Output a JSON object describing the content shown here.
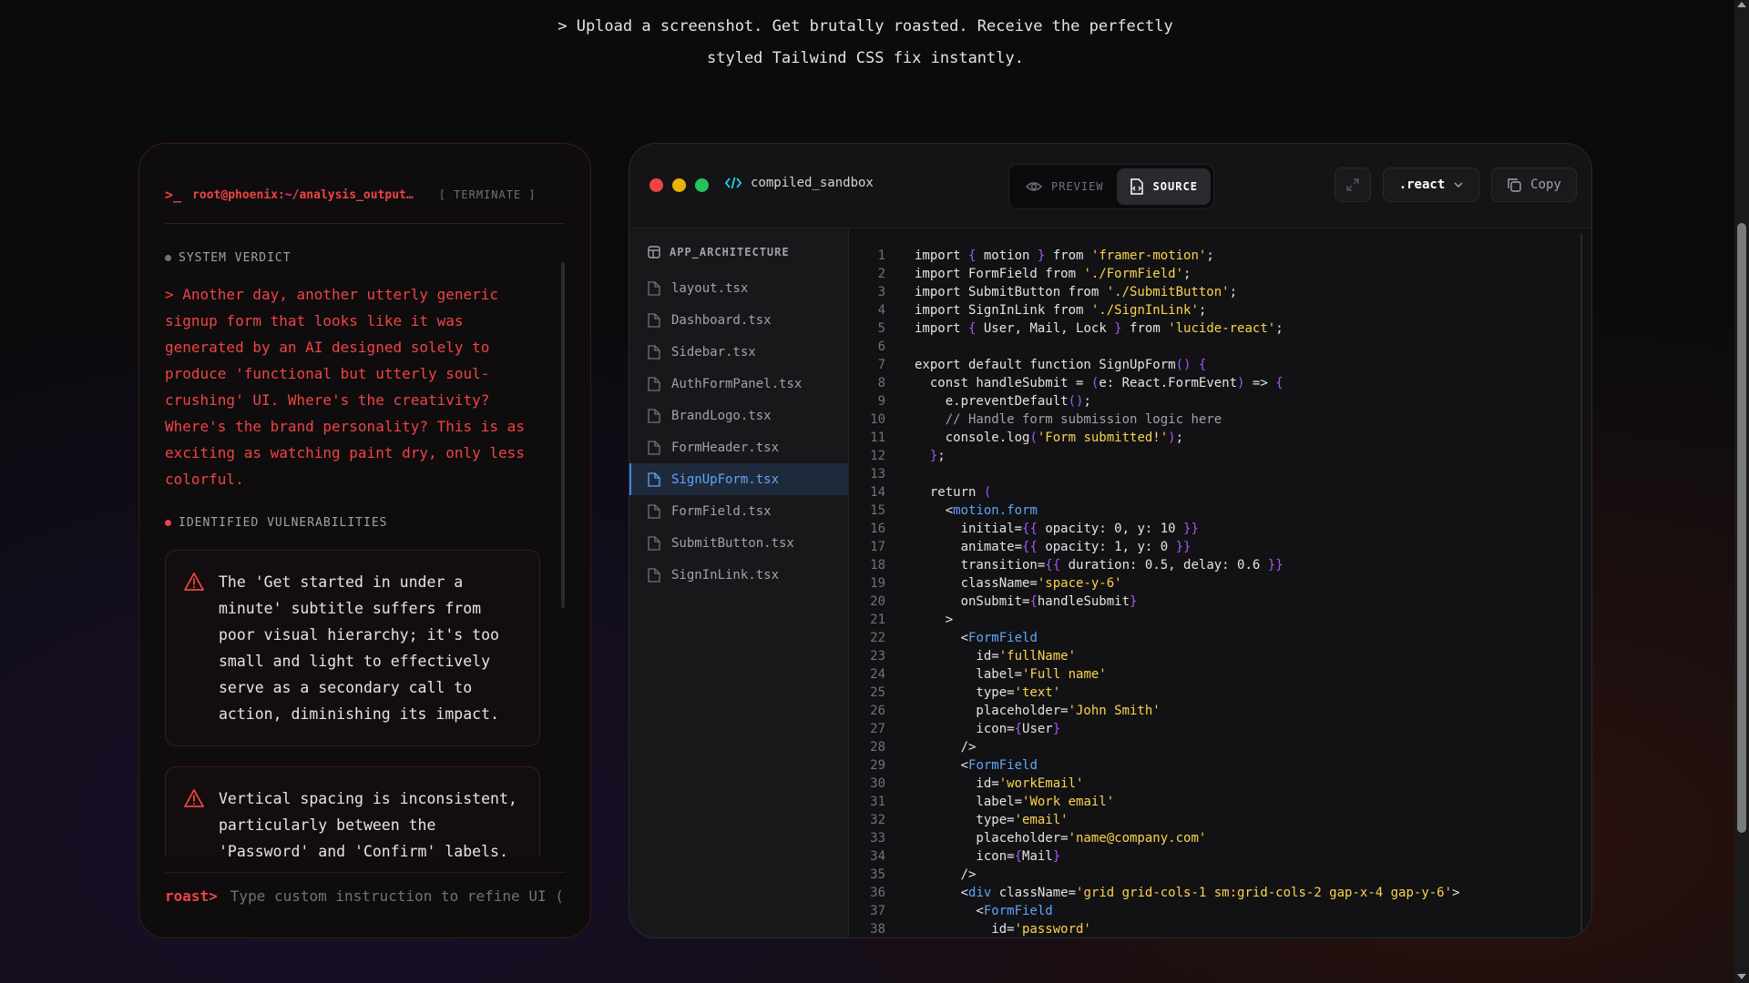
{
  "tagline": {
    "line1": "> Upload a screenshot. Get brutally roasted. Receive the perfectly",
    "line2": "styled Tailwind CSS fix instantly."
  },
  "terminal": {
    "prompt_icon": ">_",
    "path": "root@phoenix:~/analysis_output…",
    "terminate_label": "[ TERMINATE ]",
    "verdict_label": "SYSTEM VERDICT",
    "verdict_text": "> Another day, another utterly generic signup form that looks like it was generated by an AI designed solely to produce 'functional but utterly soul-crushing' UI. Where's the creativity? Where's the brand personality? This is as exciting as watching paint dry, only less colorful.",
    "vulnerabilities_label": "IDENTIFIED VULNERABILITIES",
    "vulnerabilities": [
      "The 'Get started in under a minute' subtitle suffers from poor visual hierarchy; it's too small and light to effectively serve as a secondary call to action, diminishing its impact.",
      "Vertical spacing is inconsistent, particularly between the 'Password' and 'Confirm' labels, which are crammed together"
    ],
    "input_prompt": "roast>",
    "input_placeholder": "Type custom instruction to refine UI (",
    "colors": {
      "accent": "#ef4444",
      "muted": "#71717a"
    }
  },
  "editor": {
    "title": "compiled_sandbox",
    "preview_label": "PREVIEW",
    "source_label": "SOURCE",
    "lang_label": ".react",
    "copy_label": "Copy",
    "tree_header": "APP_ARCHITECTURE",
    "files": [
      "layout.tsx",
      "Dashboard.tsx",
      "Sidebar.tsx",
      "AuthFormPanel.tsx",
      "BrandLogo.tsx",
      "FormHeader.tsx",
      "SignUpForm.tsx",
      "FormField.tsx",
      "SubmitButton.tsx",
      "SignInLink.tsx"
    ],
    "active_file": "SignUpForm.tsx",
    "code": [
      "import { motion } from 'framer-motion';",
      "import FormField from './FormField';",
      "import SubmitButton from './SubmitButton';",
      "import SignInLink from './SignInLink';",
      "import { User, Mail, Lock } from 'lucide-react';",
      "",
      "export default function SignUpForm() {",
      "  const handleSubmit = (e: React.FormEvent) => {",
      "    e.preventDefault();",
      "    // Handle form submission logic here",
      "    console.log('Form submitted!');",
      "  };",
      "",
      "  return (",
      "    <motion.form",
      "      initial={{ opacity: 0, y: 10 }}",
      "      animate={{ opacity: 1, y: 0 }}",
      "      transition={{ duration: 0.5, delay: 0.6 }}",
      "      className='space-y-6'",
      "      onSubmit={handleSubmit}",
      "    >",
      "      <FormField",
      "        id='fullName'",
      "        label='Full name'",
      "        type='text'",
      "        placeholder='John Smith'",
      "        icon={User}",
      "      />",
      "      <FormField",
      "        id='workEmail'",
      "        label='Work email'",
      "        type='email'",
      "        placeholder='name@company.com'",
      "        icon={Mail}",
      "      />",
      "      <div className='grid grid-cols-1 sm:grid-cols-2 gap-x-4 gap-y-6'>",
      "        <FormField",
      "          id='password'"
    ]
  }
}
